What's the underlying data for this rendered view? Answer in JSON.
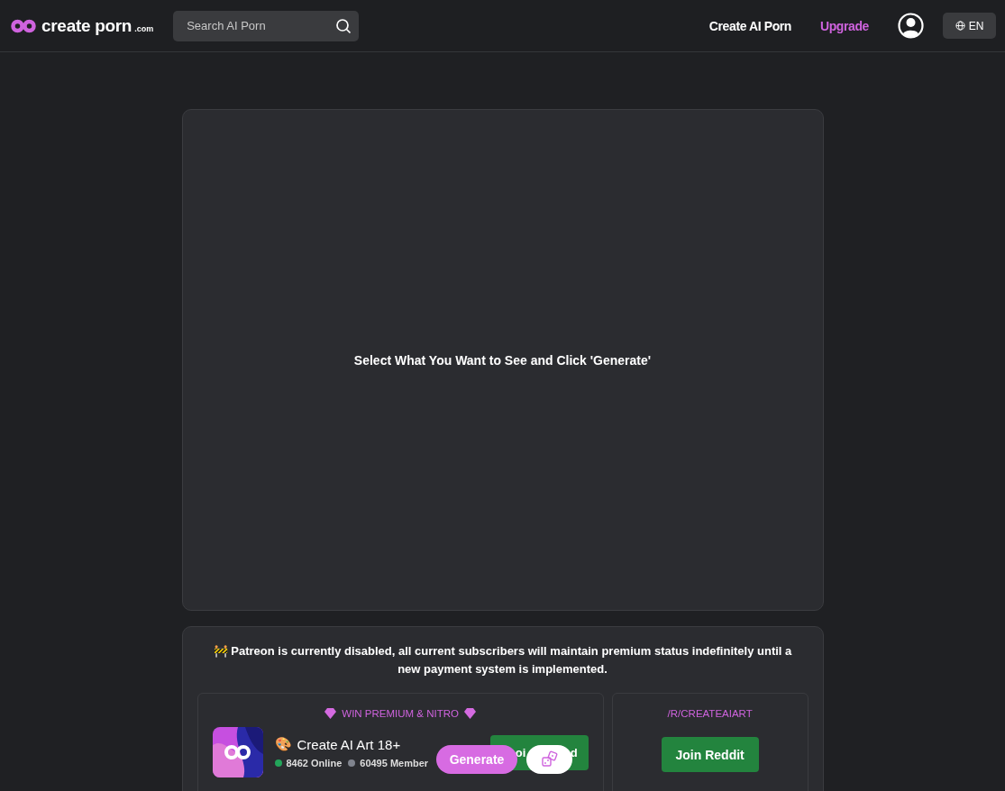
{
  "header": {
    "logo": {
      "word": "create porn",
      "suffix": ".com"
    },
    "search": {
      "placeholder": "Search AI Porn"
    },
    "nav": [
      {
        "label": "Create AI Porn",
        "kind": "link"
      },
      {
        "label": "Upgrade",
        "kind": "accent"
      }
    ],
    "language": "EN"
  },
  "canvas": {
    "message": "Select What You Want to See and Click 'Generate'"
  },
  "notice": {
    "icon": "🚧",
    "text": "Patreon is currently disabled, all current subscribers will maintain premium status indefinitely until a new payment system is implemented."
  },
  "community": [
    {
      "kind": "server",
      "heading": "WIN PREMIUM & NITRO",
      "name": "Create AI Art 18+",
      "emoji": "🎨",
      "online": "8462 Online",
      "members": "60495 Member",
      "button_parts": [
        "oi",
        "d"
      ]
    },
    {
      "kind": "reddit",
      "heading": "/R/CREATEAIART",
      "button": "Join Reddit"
    }
  ],
  "floating": {
    "generate": "Generate"
  }
}
